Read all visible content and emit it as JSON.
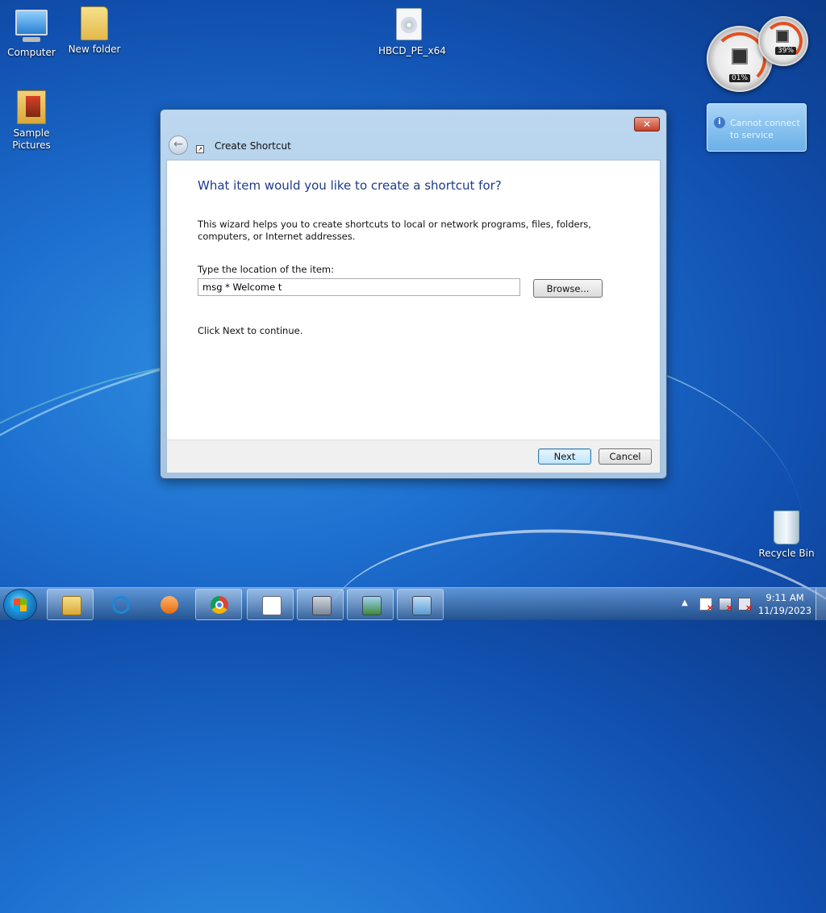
{
  "desktop": {
    "icons": {
      "computer": "Computer",
      "new_folder": "New folder",
      "hbcd": "HBCD_PE_x64",
      "sample_pictures_line1": "Sample",
      "sample_pictures_line2": "Pictures",
      "recycle_bin": "Recycle Bin"
    },
    "gadgets": {
      "cpu_percent": "01%",
      "memory_percent": "39%",
      "service_message_line1": "Cannot connect",
      "service_message_line2": "to service"
    }
  },
  "dialog": {
    "title": "Create Shortcut",
    "close_label": "✕",
    "heading": "What item would you like to create a shortcut for?",
    "description": "This wizard helps you to create shortcuts to local or network programs, files, folders, computers, or Internet addresses.",
    "location_label": "Type the location of the item:",
    "location_value": "msg * Welcome t",
    "browse_label": "Browse...",
    "continue_text": "Click Next to continue.",
    "next_label": "Next",
    "cancel_label": "Cancel"
  },
  "taskbar": {
    "pinned": [
      "windows-explorer",
      "internet-explorer",
      "media-player",
      "chrome",
      "wordpad",
      "on-screen-keyboard",
      "photo-viewer",
      "control-panel"
    ],
    "clock_time": "9:11 AM",
    "clock_date": "11/19/2023",
    "tray_arrow": "▲"
  }
}
